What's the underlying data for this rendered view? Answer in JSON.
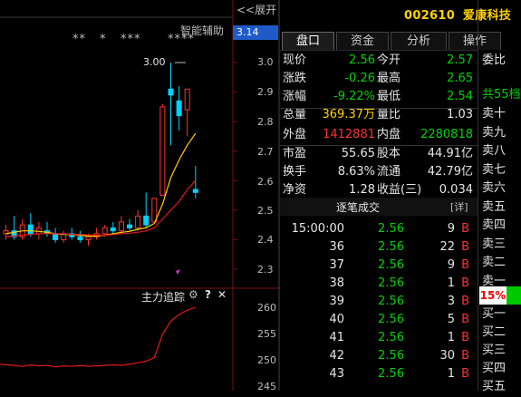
{
  "header": {
    "expand_label": "<<展开",
    "stock_code": "002610",
    "stock_name": "爱康科技",
    "smart_assist_label": "智能辅助",
    "current_price_tag": "3.14"
  },
  "chart": {
    "stars": [
      "**",
      "*",
      "***",
      "****"
    ],
    "high_label": "3.00",
    "y_ticks": [
      "3.0",
      "2.9",
      "2.8",
      "2.7",
      "2.6",
      "2.5",
      "2.4",
      "2.3"
    ],
    "indicator_title": "主力追踪",
    "indicator_y_ticks": [
      "260",
      "255",
      "250",
      "245"
    ],
    "colors": {
      "up": "#ff3232",
      "down": "#00d2ff",
      "ma5": "#ffd200",
      "ma10": "#ff3232",
      "background": "#000000"
    }
  },
  "chart_data": {
    "type": "candlestick",
    "ylim": [
      2.27,
      3.06
    ],
    "candles": [
      {
        "o": 2.42,
        "h": 2.45,
        "l": 2.4,
        "c": 2.43
      },
      {
        "o": 2.43,
        "h": 2.48,
        "l": 2.4,
        "c": 2.41
      },
      {
        "o": 2.41,
        "h": 2.47,
        "l": 2.4,
        "c": 2.45
      },
      {
        "o": 2.45,
        "h": 2.49,
        "l": 2.41,
        "c": 2.42
      },
      {
        "o": 2.42,
        "h": 2.46,
        "l": 2.4,
        "c": 2.44
      },
      {
        "o": 2.43,
        "h": 2.46,
        "l": 2.41,
        "c": 2.42
      },
      {
        "o": 2.42,
        "h": 2.44,
        "l": 2.39,
        "c": 2.4
      },
      {
        "o": 2.4,
        "h": 2.43,
        "l": 2.39,
        "c": 2.42
      },
      {
        "o": 2.42,
        "h": 2.44,
        "l": 2.4,
        "c": 2.41
      },
      {
        "o": 2.41,
        "h": 2.43,
        "l": 2.39,
        "c": 2.4
      },
      {
        "o": 2.4,
        "h": 2.42,
        "l": 2.38,
        "c": 2.41
      },
      {
        "o": 2.41,
        "h": 2.44,
        "l": 2.4,
        "c": 2.42
      },
      {
        "o": 2.42,
        "h": 2.45,
        "l": 2.41,
        "c": 2.44
      },
      {
        "o": 2.44,
        "h": 2.46,
        "l": 2.42,
        "c": 2.43
      },
      {
        "o": 2.43,
        "h": 2.48,
        "l": 2.42,
        "c": 2.46
      },
      {
        "o": 2.45,
        "h": 2.47,
        "l": 2.43,
        "c": 2.44
      },
      {
        "o": 2.44,
        "h": 2.5,
        "l": 2.43,
        "c": 2.48
      },
      {
        "o": 2.48,
        "h": 2.56,
        "l": 2.44,
        "c": 2.45
      },
      {
        "o": 2.46,
        "h": 2.54,
        "l": 2.46,
        "c": 2.54
      },
      {
        "o": 2.55,
        "h": 2.86,
        "l": 2.55,
        "c": 2.85
      },
      {
        "o": 2.91,
        "h": 3.0,
        "l": 2.72,
        "c": 2.89
      },
      {
        "o": 2.87,
        "h": 2.92,
        "l": 2.77,
        "c": 2.82
      },
      {
        "o": 2.84,
        "h": 2.91,
        "l": 2.75,
        "c": 2.91
      },
      {
        "o": 2.57,
        "h": 2.65,
        "l": 2.54,
        "c": 2.56
      }
    ],
    "ma5": [
      2.42,
      2.425,
      2.43,
      2.43,
      2.428,
      2.425,
      2.42,
      2.418,
      2.418,
      2.415,
      2.412,
      2.412,
      2.415,
      2.42,
      2.425,
      2.428,
      2.435,
      2.44,
      2.455,
      2.52,
      2.61,
      2.67,
      2.72,
      2.76
    ],
    "ma10": [
      2.41,
      2.412,
      2.415,
      2.418,
      2.42,
      2.42,
      2.42,
      2.42,
      2.418,
      2.418,
      2.416,
      2.415,
      2.415,
      2.417,
      2.42,
      2.422,
      2.425,
      2.43,
      2.44,
      2.47,
      2.5,
      2.53,
      2.57,
      2.6
    ],
    "indicator": {
      "ylim": [
        242,
        262
      ],
      "values": [
        249.2,
        249.0,
        248.8,
        249.1,
        248.9,
        249.0,
        248.7,
        248.9,
        248.8,
        249.0,
        248.8,
        248.9,
        249.0,
        249.1,
        249.0,
        249.2,
        249.5,
        249.8,
        250.5,
        255.0,
        257.5,
        258.8,
        259.6,
        260.2
      ]
    }
  },
  "tabs": [
    "盘口",
    "资金",
    "分析",
    "操作"
  ],
  "quote": {
    "rows": [
      {
        "l1": "现价",
        "v1": "2.56",
        "c1": "green",
        "l2": "今开",
        "v2": "2.57",
        "c2": "green"
      },
      {
        "l1": "涨跌",
        "v1": "-0.26",
        "c1": "green",
        "l2": "最高",
        "v2": "2.65",
        "c2": "green"
      },
      {
        "l1": "涨幅",
        "v1": "-9.22%",
        "c1": "green",
        "l2": "最低",
        "v2": "2.54",
        "c2": "green"
      },
      {
        "l1": "总量",
        "v1": "369.37万",
        "c1": "yellow",
        "l2": "量比",
        "v2": "1.03",
        "c2": "white"
      },
      {
        "l1": "外盘",
        "v1": "1412881",
        "c1": "red",
        "l2": "内盘",
        "v2": "2280818",
        "c2": "green"
      },
      {
        "l1": "市盈",
        "v1": "55.65",
        "c1": "white",
        "l2": "股本",
        "v2": "44.91亿",
        "c2": "white"
      },
      {
        "l1": "换手",
        "v1": "8.63%",
        "c1": "white",
        "l2": "流通",
        "v2": "42.79亿",
        "c2": "white"
      },
      {
        "l1": "净资",
        "v1": "1.28",
        "c1": "white",
        "l2": "收益(三)",
        "v2": "0.034",
        "c2": "white"
      }
    ]
  },
  "trades": {
    "title": "逐笔成交",
    "detail_label": "[详]",
    "rows": [
      {
        "t": "15:00:00",
        "p": "2.56",
        "v": "9",
        "s": "B"
      },
      {
        "t": "36",
        "p": "2.56",
        "v": "22",
        "s": "B"
      },
      {
        "t": "37",
        "p": "2.56",
        "v": "9",
        "s": "B"
      },
      {
        "t": "38",
        "p": "2.56",
        "v": "1",
        "s": "B"
      },
      {
        "t": "39",
        "p": "2.56",
        "v": "3",
        "s": "B"
      },
      {
        "t": "40",
        "p": "2.56",
        "v": "5",
        "s": "B"
      },
      {
        "t": "41",
        "p": "2.56",
        "v": "1",
        "s": "B"
      },
      {
        "t": "42",
        "p": "2.56",
        "v": "30",
        "s": "B"
      },
      {
        "t": "43",
        "p": "2.56",
        "v": "1",
        "s": "B"
      }
    ]
  },
  "orderbook": {
    "weibi_label": "委比",
    "total_label": "共55档",
    "sell_levels": [
      "卖十",
      "卖九",
      "卖八",
      "卖七",
      "卖六",
      "卖五",
      "卖四",
      "卖三",
      "卖二",
      "卖一"
    ],
    "pct": "15%",
    "buy_levels": [
      "买一",
      "买二",
      "买三",
      "买四",
      "买五"
    ]
  }
}
